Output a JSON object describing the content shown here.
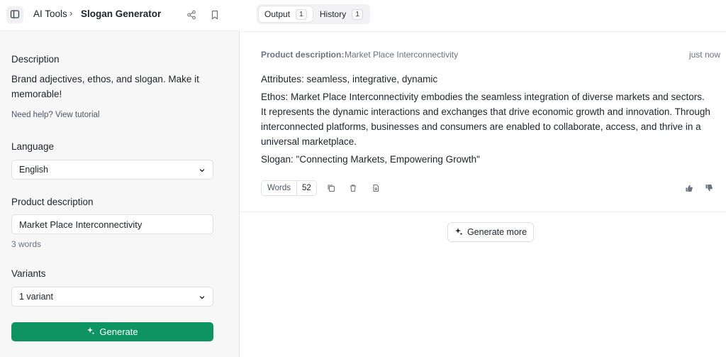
{
  "header": {
    "breadcrumb_root": "AI Tools",
    "breadcrumb_separator": "›",
    "breadcrumb_current": "Slogan Generator",
    "icons": [
      "sidebar-toggle-icon",
      "share-icon",
      "bookmark-icon"
    ]
  },
  "sidebar": {
    "description_title": "Description",
    "description_text": "Brand adjectives, ethos, and slogan. Make it memorable!",
    "help_link": "Need help? View tutorial",
    "language_title": "Language",
    "language_value": "English",
    "product_title": "Product description",
    "product_value": "Market Place Interconnectivity",
    "product_word_count": "3 words",
    "variants_title": "Variants",
    "variants_value": "1 variant",
    "generate_label": "Generate"
  },
  "tabs": [
    {
      "label": "Output",
      "count": "1",
      "active": true
    },
    {
      "label": "History",
      "count": "1",
      "active": false
    }
  ],
  "output": {
    "meta_label": "Product description:",
    "meta_value": "Market Place Interconnectivity",
    "timestamp": "just now",
    "attributes": "Attributes: seamless, integrative, dynamic",
    "ethos": "Ethos: Market Place Interconnectivity embodies the seamless integration of diverse markets and sectors. It represents the dynamic interactions and exchanges that drive economic growth and innovation. Through interconnected platforms, businesses and consumers are enabled to collaborate, access, and thrive in a universal marketplace.",
    "slogan": "Slogan: \"Connecting Markets, Empowering Growth\"",
    "words_label": "Words",
    "words_count": "52",
    "action_icons": [
      "copy-icon",
      "trash-icon",
      "export-icon",
      "thumbs-up-icon",
      "thumbs-down-icon"
    ],
    "generate_more_label": "Generate more"
  },
  "colors": {
    "accent": "#0d9462",
    "panel_bg": "#f7f7f8",
    "border": "#e1e1e5",
    "muted_text": "#6b7280"
  }
}
